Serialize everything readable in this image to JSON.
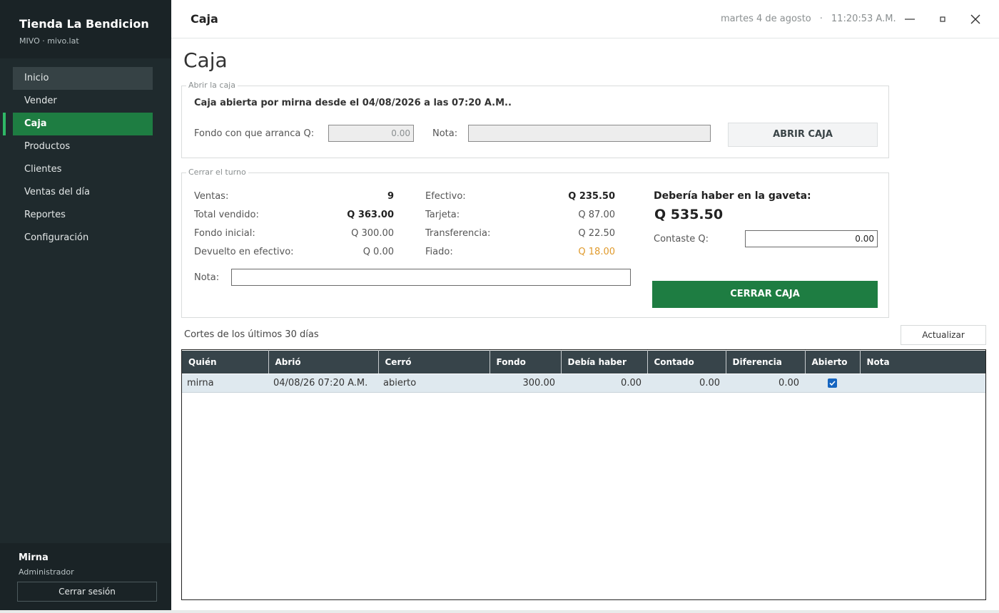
{
  "sidebar": {
    "title": "Tienda La Bendicion",
    "subtitle": "MIVO · mivo.lat",
    "items": [
      {
        "label": "Inicio"
      },
      {
        "label": "Vender"
      },
      {
        "label": "Caja"
      },
      {
        "label": "Productos"
      },
      {
        "label": "Clientes"
      },
      {
        "label": "Ventas del día"
      },
      {
        "label": "Reportes"
      },
      {
        "label": "Configuración"
      }
    ],
    "user": {
      "name": "Mirna",
      "role": "Administrador"
    },
    "logout_label": "Cerrar sesión"
  },
  "topbar": {
    "title": "Caja",
    "date": "martes 4 de agosto",
    "separator": "·",
    "time": "11:20:53 A.M."
  },
  "main": {
    "page_title": "Caja",
    "abrir": {
      "legend": "Abrir la caja",
      "status": "Caja abierta por mirna desde el 04/08/2026 a las 07:20 A.M..",
      "fondo_label": "Fondo con que arranca Q:",
      "fondo_value": "0.00",
      "nota_label": "Nota:",
      "nota_value": "",
      "button": "ABRIR CAJA"
    },
    "cerrar": {
      "legend": "Cerrar el turno",
      "stats_left": [
        {
          "label": "Ventas:",
          "value": "9"
        },
        {
          "label": "Total vendido:",
          "value": "Q 363.00"
        },
        {
          "label": "Fondo inicial:",
          "value": "Q 300.00"
        },
        {
          "label": "Devuelto en efectivo:",
          "value": "Q 0.00"
        }
      ],
      "stats_right": [
        {
          "label": "Efectivo:",
          "value": "Q 235.50"
        },
        {
          "label": "Tarjeta:",
          "value": "Q 87.00"
        },
        {
          "label": "Transferencia:",
          "value": "Q 22.50"
        },
        {
          "label": "Fiado:",
          "value": "Q 18.00"
        }
      ],
      "deberia_label": "Debería haber en la gaveta:",
      "deberia_value": "Q 535.50",
      "contaste_label": "Contaste Q:",
      "contaste_value": "0.00",
      "nota_label": "Nota:",
      "nota_value": "",
      "button": "CERRAR CAJA"
    },
    "cortes_label": "Cortes de los últimos 30 días",
    "actualizar_label": "Actualizar",
    "table": {
      "headers": [
        "Quién",
        "Abrió",
        "Cerró",
        "Fondo",
        "Debía haber",
        "Contado",
        "Diferencia",
        "Abierto",
        "Nota"
      ],
      "rows": [
        {
          "quien": "mirna",
          "abrio": "04/08/26 07:20 A.M.",
          "cerro": "abierto",
          "fondo": "300.00",
          "debia": "0.00",
          "contado": "0.00",
          "diferencia": "0.00",
          "abierto": true,
          "nota": ""
        }
      ]
    }
  },
  "colors": {
    "sidebar_bg": "#1f2a2d",
    "accent_green": "#1e7d42",
    "header_bg": "#37444a",
    "fiado_orange": "#e09a2c",
    "row_selected": "#dfe9ef"
  }
}
